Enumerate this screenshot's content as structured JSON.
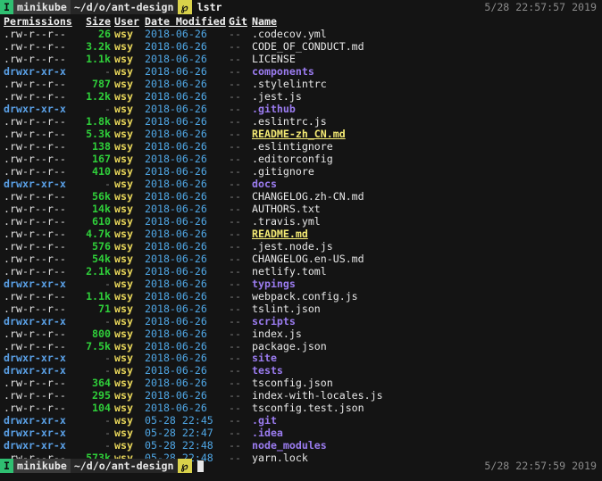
{
  "top_prompt": {
    "mode": "I",
    "host": "minikube",
    "dir": "~/d/o/ant-design",
    "vcs": "℘",
    "command": "lstr",
    "timestamp": "5/28 22:57:57 2019"
  },
  "bottom_prompt": {
    "mode": "I",
    "host": "minikube",
    "dir": "~/d/o/ant-design",
    "vcs": "℘",
    "command": "",
    "timestamp": "5/28 22:57:59 2019"
  },
  "headers": {
    "permissions": "Permissions",
    "size": "Size",
    "user": "User",
    "date": "Date Modified",
    "git": "Git",
    "name": "Name"
  },
  "files": [
    {
      "perm": ".rw-r--r--",
      "size": "26",
      "user": "wsy",
      "date": "2018-06-26",
      "git": "--",
      "name": ".codecov.yml",
      "type": "file"
    },
    {
      "perm": ".rw-r--r--",
      "size": "3.2k",
      "user": "wsy",
      "date": "2018-06-26",
      "git": "--",
      "name": "CODE_OF_CONDUCT.md",
      "type": "file"
    },
    {
      "perm": ".rw-r--r--",
      "size": "1.1k",
      "user": "wsy",
      "date": "2018-06-26",
      "git": "--",
      "name": "LICENSE",
      "type": "file"
    },
    {
      "perm": "drwxr-xr-x",
      "size": "-",
      "user": "wsy",
      "date": "2018-06-26",
      "git": "--",
      "name": "components",
      "type": "dir"
    },
    {
      "perm": ".rw-r--r--",
      "size": "787",
      "user": "wsy",
      "date": "2018-06-26",
      "git": "--",
      "name": ".stylelintrc",
      "type": "file"
    },
    {
      "perm": ".rw-r--r--",
      "size": "1.2k",
      "user": "wsy",
      "date": "2018-06-26",
      "git": "--",
      "name": ".jest.js",
      "type": "file"
    },
    {
      "perm": "drwxr-xr-x",
      "size": "-",
      "user": "wsy",
      "date": "2018-06-26",
      "git": "--",
      "name": ".github",
      "type": "dir"
    },
    {
      "perm": ".rw-r--r--",
      "size": "1.8k",
      "user": "wsy",
      "date": "2018-06-26",
      "git": "--",
      "name": ".eslintrc.js",
      "type": "file"
    },
    {
      "perm": ".rw-r--r--",
      "size": "5.3k",
      "user": "wsy",
      "date": "2018-06-26",
      "git": "--",
      "name": "README-zh_CN.md",
      "type": "hl"
    },
    {
      "perm": ".rw-r--r--",
      "size": "138",
      "user": "wsy",
      "date": "2018-06-26",
      "git": "--",
      "name": ".eslintignore",
      "type": "file"
    },
    {
      "perm": ".rw-r--r--",
      "size": "167",
      "user": "wsy",
      "date": "2018-06-26",
      "git": "--",
      "name": ".editorconfig",
      "type": "file"
    },
    {
      "perm": ".rw-r--r--",
      "size": "410",
      "user": "wsy",
      "date": "2018-06-26",
      "git": "--",
      "name": ".gitignore",
      "type": "file"
    },
    {
      "perm": "drwxr-xr-x",
      "size": "-",
      "user": "wsy",
      "date": "2018-06-26",
      "git": "--",
      "name": "docs",
      "type": "dir"
    },
    {
      "perm": ".rw-r--r--",
      "size": "56k",
      "user": "wsy",
      "date": "2018-06-26",
      "git": "--",
      "name": "CHANGELOG.zh-CN.md",
      "type": "file"
    },
    {
      "perm": ".rw-r--r--",
      "size": "14k",
      "user": "wsy",
      "date": "2018-06-26",
      "git": "--",
      "name": "AUTHORS.txt",
      "type": "file"
    },
    {
      "perm": ".rw-r--r--",
      "size": "610",
      "user": "wsy",
      "date": "2018-06-26",
      "git": "--",
      "name": ".travis.yml",
      "type": "file"
    },
    {
      "perm": ".rw-r--r--",
      "size": "4.7k",
      "user": "wsy",
      "date": "2018-06-26",
      "git": "--",
      "name": "README.md",
      "type": "hl"
    },
    {
      "perm": ".rw-r--r--",
      "size": "576",
      "user": "wsy",
      "date": "2018-06-26",
      "git": "--",
      "name": ".jest.node.js",
      "type": "file"
    },
    {
      "perm": ".rw-r--r--",
      "size": "54k",
      "user": "wsy",
      "date": "2018-06-26",
      "git": "--",
      "name": "CHANGELOG.en-US.md",
      "type": "file"
    },
    {
      "perm": ".rw-r--r--",
      "size": "2.1k",
      "user": "wsy",
      "date": "2018-06-26",
      "git": "--",
      "name": "netlify.toml",
      "type": "file"
    },
    {
      "perm": "drwxr-xr-x",
      "size": "-",
      "user": "wsy",
      "date": "2018-06-26",
      "git": "--",
      "name": "typings",
      "type": "dir"
    },
    {
      "perm": ".rw-r--r--",
      "size": "1.1k",
      "user": "wsy",
      "date": "2018-06-26",
      "git": "--",
      "name": "webpack.config.js",
      "type": "file"
    },
    {
      "perm": ".rw-r--r--",
      "size": "71",
      "user": "wsy",
      "date": "2018-06-26",
      "git": "--",
      "name": "tslint.json",
      "type": "file"
    },
    {
      "perm": "drwxr-xr-x",
      "size": "-",
      "user": "wsy",
      "date": "2018-06-26",
      "git": "--",
      "name": "scripts",
      "type": "dir"
    },
    {
      "perm": ".rw-r--r--",
      "size": "800",
      "user": "wsy",
      "date": "2018-06-26",
      "git": "--",
      "name": "index.js",
      "type": "file"
    },
    {
      "perm": ".rw-r--r--",
      "size": "7.5k",
      "user": "wsy",
      "date": "2018-06-26",
      "git": "--",
      "name": "package.json",
      "type": "file"
    },
    {
      "perm": "drwxr-xr-x",
      "size": "-",
      "user": "wsy",
      "date": "2018-06-26",
      "git": "--",
      "name": "site",
      "type": "dir"
    },
    {
      "perm": "drwxr-xr-x",
      "size": "-",
      "user": "wsy",
      "date": "2018-06-26",
      "git": "--",
      "name": "tests",
      "type": "dir"
    },
    {
      "perm": ".rw-r--r--",
      "size": "364",
      "user": "wsy",
      "date": "2018-06-26",
      "git": "--",
      "name": "tsconfig.json",
      "type": "file"
    },
    {
      "perm": ".rw-r--r--",
      "size": "295",
      "user": "wsy",
      "date": "2018-06-26",
      "git": "--",
      "name": "index-with-locales.js",
      "type": "file"
    },
    {
      "perm": ".rw-r--r--",
      "size": "104",
      "user": "wsy",
      "date": "2018-06-26",
      "git": "--",
      "name": "tsconfig.test.json",
      "type": "file"
    },
    {
      "perm": "drwxr-xr-x",
      "size": "-",
      "user": "wsy",
      "date": "05-28 22:45",
      "git": "--",
      "name": ".git",
      "type": "dir"
    },
    {
      "perm": "drwxr-xr-x",
      "size": "-",
      "user": "wsy",
      "date": "05-28 22:47",
      "git": "--",
      "name": ".idea",
      "type": "dir"
    },
    {
      "perm": "drwxr-xr-x",
      "size": "-",
      "user": "wsy",
      "date": "05-28 22:48",
      "git": "--",
      "name": "node_modules",
      "type": "dir"
    },
    {
      "perm": ".rw-r--r--",
      "size": "573k",
      "user": "wsy",
      "date": "05-28 22:48",
      "git": "--",
      "name": "yarn.lock",
      "type": "file"
    }
  ]
}
